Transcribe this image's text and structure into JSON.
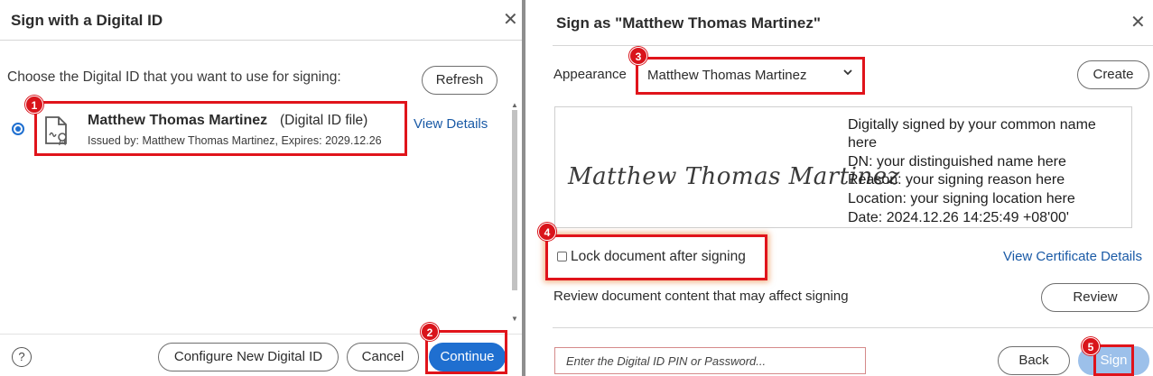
{
  "left": {
    "title": "Sign with a Digital ID",
    "close_glyph": "✕",
    "prompt": "Choose the Digital ID that you want to use for signing:",
    "refresh_label": "Refresh",
    "id_entry": {
      "name": "Matthew Thomas Martinez",
      "type": "(Digital ID file)",
      "issued": "Issued by: Matthew Thomas Martinez, Expires: 2029.12.26",
      "view_details": "View Details"
    },
    "help_glyph": "?",
    "configure_label": "Configure New Digital ID",
    "cancel_label": "Cancel",
    "continue_label": "Continue"
  },
  "right": {
    "title": "Sign as \"Matthew Thomas Martinez\"",
    "close_glyph": "✕",
    "appearance_label": "Appearance",
    "appearance_value": "Matthew Thomas Martinez",
    "create_label": "Create",
    "signature_script": "Matthew Thomas Martinez",
    "signature_details": [
      "Digitally signed by your common name",
      "here",
      "DN: your distinguished name here",
      "Reason: your signing reason here",
      "Location: your signing location here",
      "Date: 2024.12.26 14:25:49 +08'00'"
    ],
    "lock_label": "Lock document after signing",
    "view_cert_label": "View Certificate Details",
    "review_text": "Review document content that may affect signing",
    "review_label": "Review",
    "pin_placeholder": "Enter the Digital ID PIN or Password...",
    "back_label": "Back",
    "sign_label": "Sign"
  },
  "markers": [
    "1",
    "2",
    "3",
    "4",
    "5"
  ],
  "colors": {
    "accent": "#1f6fd0",
    "annotation": "#e0141b",
    "link": "#1a5aa6"
  },
  "icons": {
    "id_file": "certificate-file-icon",
    "dropdown": "chevron-down-icon",
    "help": "help-icon",
    "close": "close-icon"
  }
}
